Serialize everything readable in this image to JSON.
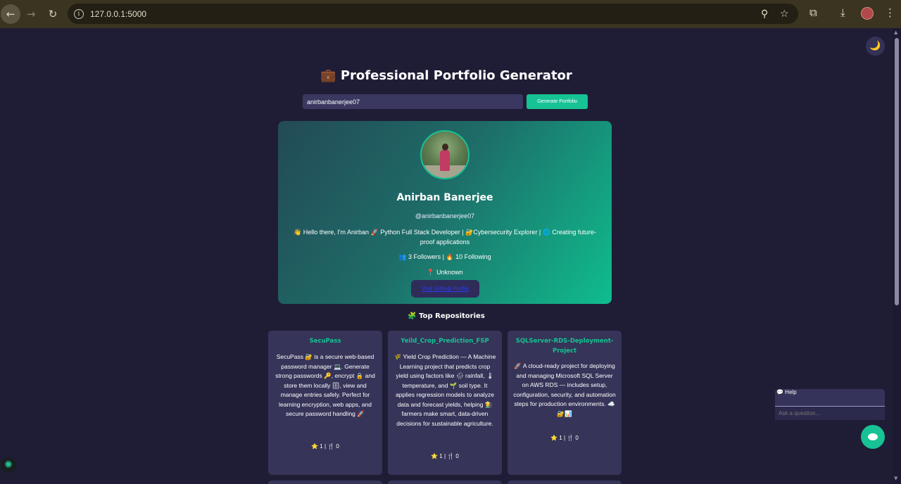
{
  "browser": {
    "url": "127.0.0.1:5000",
    "back_icon": "←",
    "forward_icon": "→",
    "reload_icon": "↻",
    "info_icon": "i",
    "zoom_icon": "⚲",
    "star_icon": "☆",
    "extensions_icon": "⧉",
    "download_icon": "⤓",
    "menu_icon": "⋮"
  },
  "page": {
    "theme_toggle_icon": "🌙",
    "title": "💼 Professional Portfolio Generator",
    "search": {
      "value": "anirbanbanerjee07"
    },
    "generate_label": "Generate Portfolio"
  },
  "profile": {
    "name": "Anirban Banerjee",
    "handle": "@anirbanbanerjee07",
    "bio": "👋 Hello there, I'm Anirban 🚀 Python Full Stack Developer | 🔐Cybersecurity Explorer | 🌐 Creating future-proof applications",
    "stats": "👥 3 Followers | 🔥 10 Following",
    "location": "📍 Unknown",
    "link_label": "Visit GitHub Profile"
  },
  "repos_heading": "🧩 Top Repositories",
  "repos": [
    {
      "name": "SecuPass",
      "description": "SecuPass 🔐 is a secure web-based password manager 💻. Generate strong passwords 🔑, encrypt 🔒 and store them locally 🗄, view and manage entries safely. Perfect for learning encryption, web apps, and secure password handling 🚀",
      "stats": "⭐ 1 | 🍴 0"
    },
    {
      "name": "Yeild_Crop_Prediction_FSP",
      "description": "🌾 Yield Crop Prediction — A Machine Learning project that predicts crop yield using factors like 🌧 rainfall, 🌡 temperature, and 🌱 soil type. It applies regression models to analyze data and forecast yields, helping 👨‍🌾 farmers make smart, data-driven decisions for sustainable agriculture.",
      "stats": "⭐ 1 | 🍴 0"
    },
    {
      "name": "SQLServer-RDS-Deployment-Project",
      "description": "🚀 A cloud-ready project for deploying and managing Microsoft SQL Server on AWS RDS — includes setup, configuration, security, and automation steps for production environments. ☁️🔐📊",
      "stats": "⭐ 1 | 🍴 0"
    }
  ],
  "help": {
    "title": "💬 Help",
    "placeholder": "Ask a question..."
  }
}
